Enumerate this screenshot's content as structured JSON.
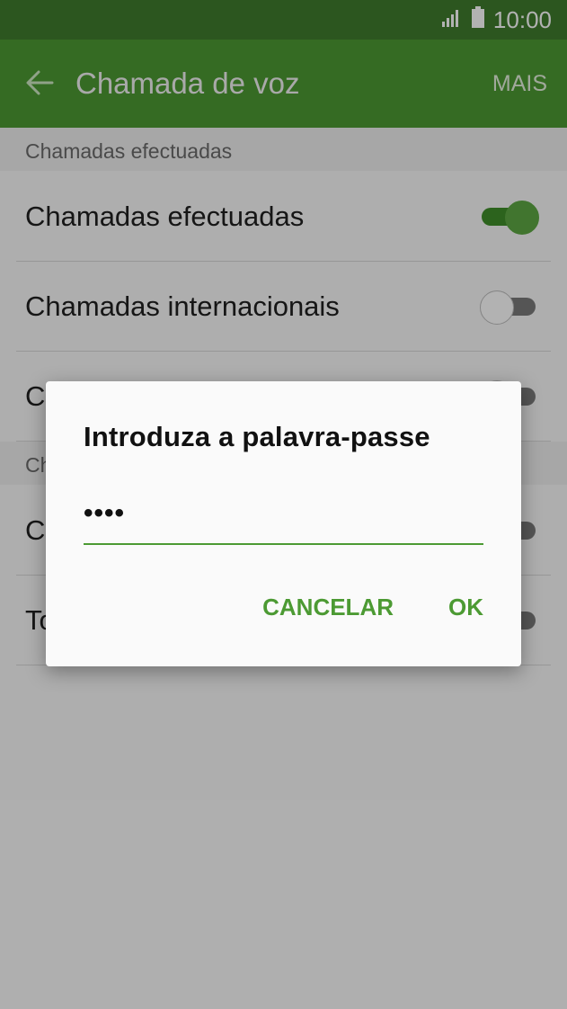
{
  "status_bar": {
    "time": "10:00",
    "icons": [
      "signal-icon",
      "battery-icon"
    ]
  },
  "app_bar": {
    "back_icon": "arrow-left-icon",
    "title": "Chamada de voz",
    "more_label": "MAIS"
  },
  "sections": [
    {
      "header": "Chamadas efectuadas",
      "items": [
        {
          "label": "Chamadas efectuadas",
          "toggle_on": true
        },
        {
          "label": "Chamadas internacionais",
          "toggle_on": false
        },
        {
          "label": "C",
          "toggle_on": false
        }
      ]
    },
    {
      "header": "Ch",
      "items": [
        {
          "label": "C",
          "toggle_on": false
        },
        {
          "label": "To",
          "toggle_on": false
        }
      ]
    }
  ],
  "dialog": {
    "title": "Introduza a palavra-passe",
    "password_masked": "••••",
    "cancel_label": "CANCELAR",
    "ok_label": "OK"
  },
  "colors": {
    "accent": "#4c9a33",
    "status_bar": "#3f7b2d"
  }
}
